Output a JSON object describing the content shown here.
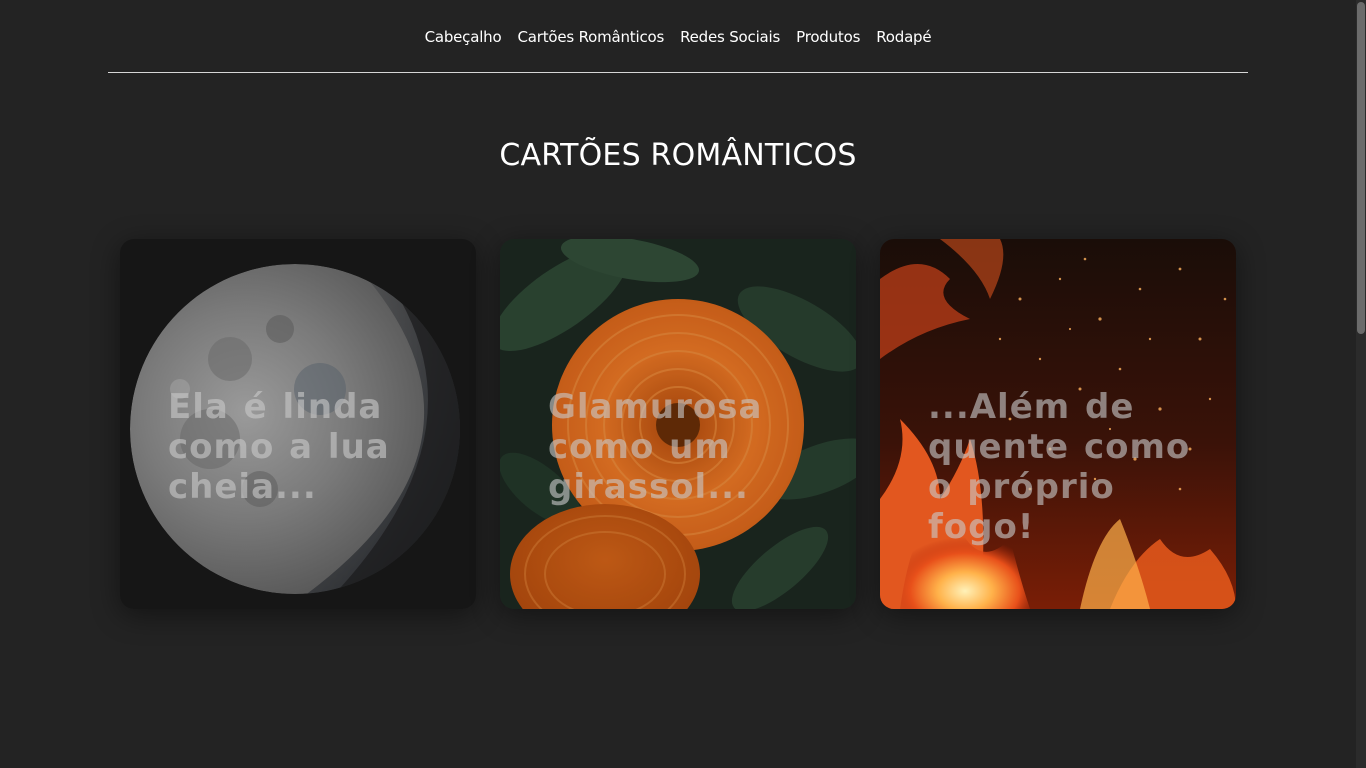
{
  "nav": {
    "items": [
      {
        "label": "Cabeçalho"
      },
      {
        "label": "Cartões Românticos"
      },
      {
        "label": "Redes Sociais"
      },
      {
        "label": "Produtos"
      },
      {
        "label": "Rodapé"
      }
    ]
  },
  "section": {
    "title": "CARTÕES ROMÂNTICOS"
  },
  "cards": [
    {
      "text": "Ela é linda como a lua cheia...",
      "image": "moon-image"
    },
    {
      "text": "Glamurosa como um girassol...",
      "image": "orange-flower-image"
    },
    {
      "text": "...Além de quente como o próprio fogo!",
      "image": "fire-image"
    }
  ]
}
